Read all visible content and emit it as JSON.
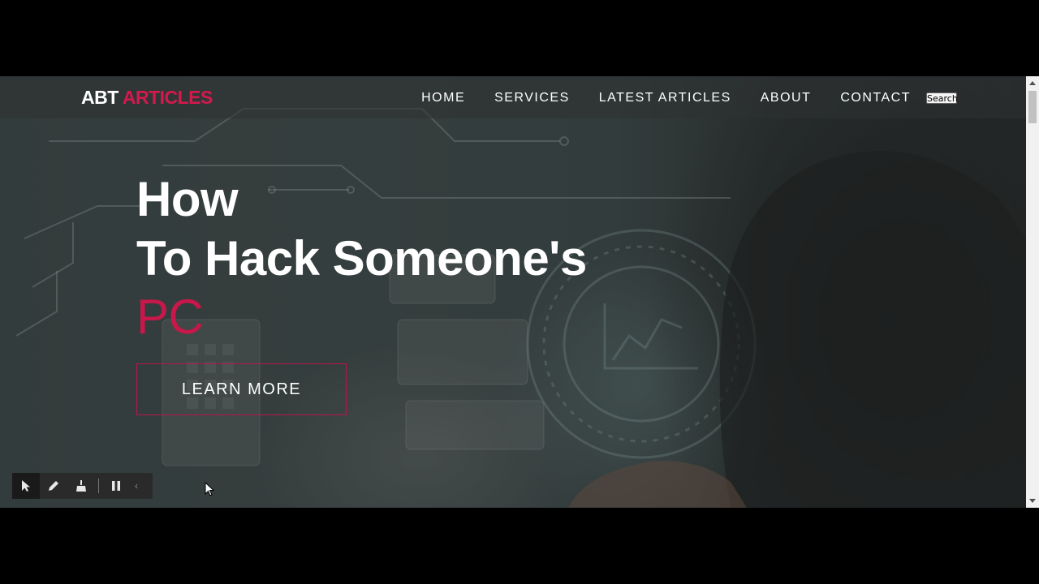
{
  "brand": {
    "part1": "ABT",
    "part2": "ARTICLES"
  },
  "nav": {
    "items": [
      {
        "label": "HOME"
      },
      {
        "label": "SERVICES"
      },
      {
        "label": "LATEST ARTICLES"
      },
      {
        "label": "ABOUT"
      },
      {
        "label": "CONTACT"
      }
    ],
    "search_label": "Search"
  },
  "hero": {
    "line1": "How",
    "line2": "To Hack Someone's",
    "line3": "PC",
    "cta_label": "LEARN MORE"
  },
  "toolbar": {
    "tools": [
      "pointer-icon",
      "pencil-icon",
      "broom-icon",
      "pause-icon",
      "chevron-left-icon"
    ]
  },
  "colors": {
    "accent": "#d6184d",
    "nav_text": "#ffffff",
    "page_frame": "#000000"
  }
}
